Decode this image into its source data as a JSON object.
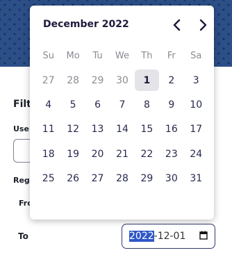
{
  "page": {
    "filter_label": "Filt",
    "user_label": "Use",
    "reg_label": "Regi",
    "from_label": "Fro",
    "to_label": "To"
  },
  "to_input": {
    "year": "2022",
    "rest": "-12-01"
  },
  "calendar": {
    "month_label": "December 2022",
    "prev_icon": "chevron-left-icon",
    "next_icon": "chevron-right-icon",
    "weekdays": [
      "Su",
      "Mo",
      "Tu",
      "We",
      "Th",
      "Fr",
      "Sa"
    ],
    "weeks": [
      [
        {
          "d": "27",
          "other": true
        },
        {
          "d": "28",
          "other": true
        },
        {
          "d": "29",
          "other": true
        },
        {
          "d": "30",
          "other": true
        },
        {
          "d": "1",
          "today": true
        },
        {
          "d": "2"
        },
        {
          "d": "3"
        }
      ],
      [
        {
          "d": "4"
        },
        {
          "d": "5"
        },
        {
          "d": "6"
        },
        {
          "d": "7"
        },
        {
          "d": "8"
        },
        {
          "d": "9"
        },
        {
          "d": "10"
        }
      ],
      [
        {
          "d": "11"
        },
        {
          "d": "12"
        },
        {
          "d": "13"
        },
        {
          "d": "14"
        },
        {
          "d": "15"
        },
        {
          "d": "16"
        },
        {
          "d": "17"
        }
      ],
      [
        {
          "d": "18"
        },
        {
          "d": "19"
        },
        {
          "d": "20"
        },
        {
          "d": "21"
        },
        {
          "d": "22"
        },
        {
          "d": "23"
        },
        {
          "d": "24"
        }
      ],
      [
        {
          "d": "25"
        },
        {
          "d": "26"
        },
        {
          "d": "27"
        },
        {
          "d": "28"
        },
        {
          "d": "29"
        },
        {
          "d": "30"
        },
        {
          "d": "31"
        }
      ]
    ]
  }
}
